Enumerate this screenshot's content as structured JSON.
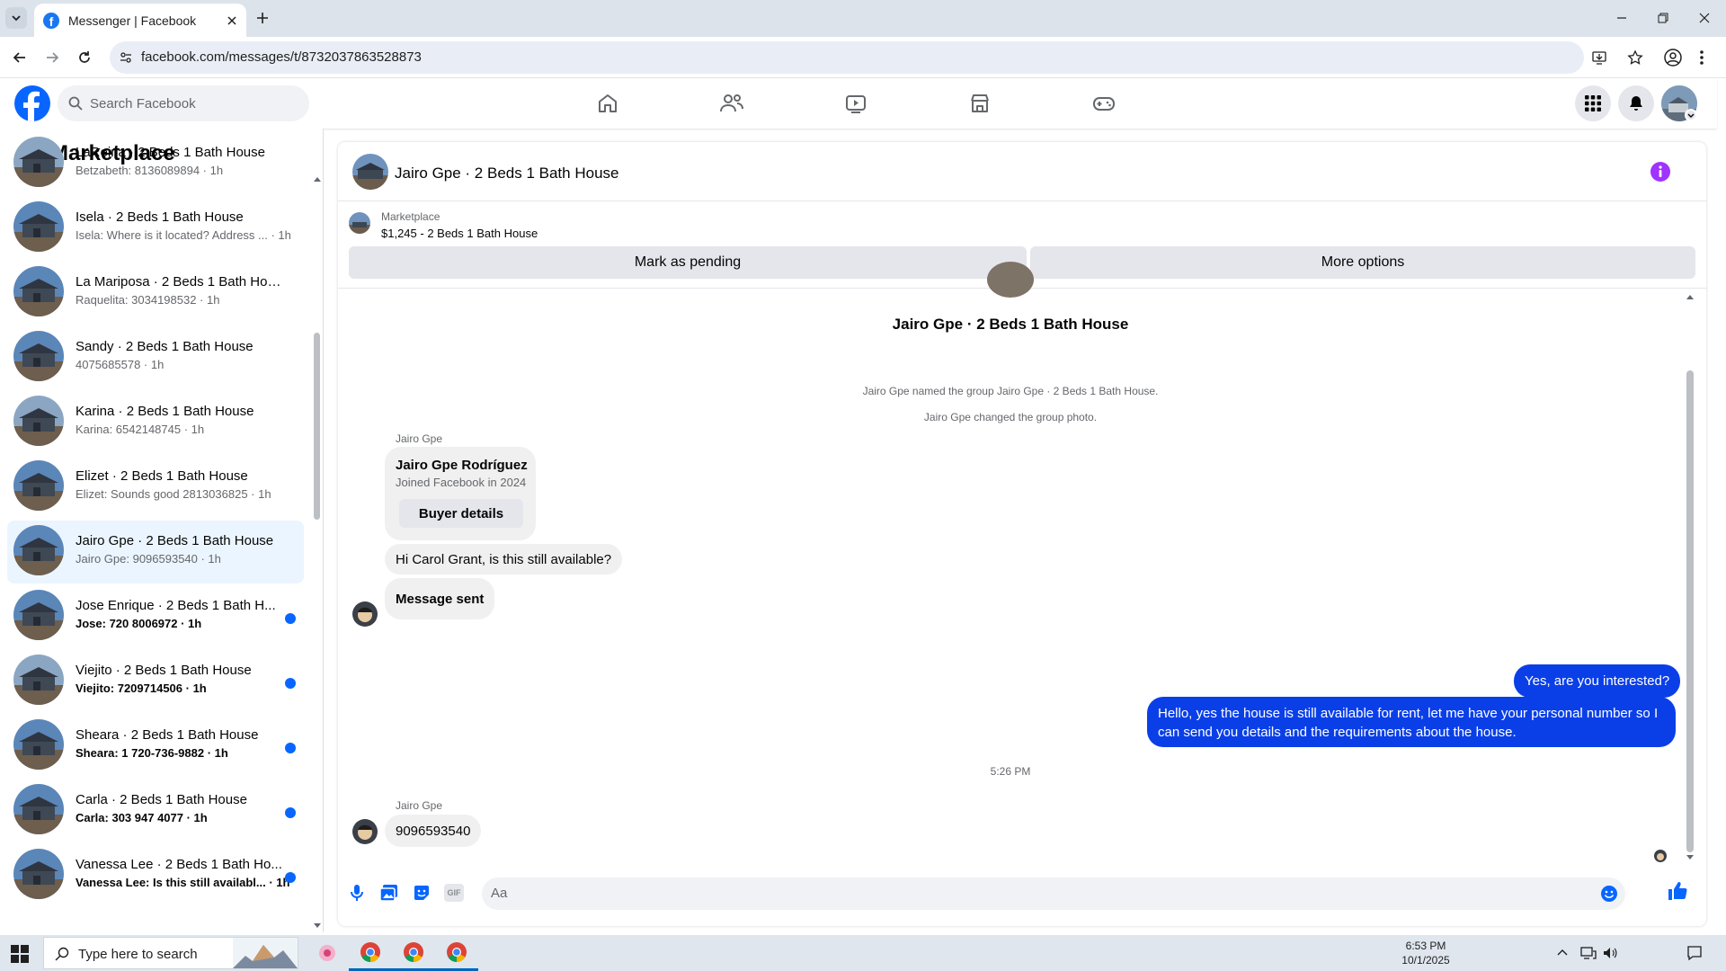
{
  "browser": {
    "tab_title": "Messenger | Facebook",
    "url": "facebook.com/messages/t/8732037863528873"
  },
  "fb_header": {
    "search_placeholder": "Search Facebook"
  },
  "left_pane": {
    "title": "Marketplace",
    "conversations": [
      {
        "name": "LaReina · 2 Beds 1 Bath House",
        "preview": "Betzabeth: 8136089894 · 1h",
        "unread": false,
        "selected": false
      },
      {
        "name": "Isela · 2 Beds 1 Bath House",
        "preview": "Isela: Where is it located? Address ... · 1h",
        "unread": false,
        "selected": false
      },
      {
        "name": "La Mariposa · 2 Beds 1 Bath House",
        "preview": "Raquelita: 3034198532 · 1h",
        "unread": false,
        "selected": false
      },
      {
        "name": "Sandy · 2 Beds 1 Bath House",
        "preview": "4075685578 · 1h",
        "unread": false,
        "selected": false
      },
      {
        "name": "Karina · 2 Beds 1 Bath House",
        "preview": "Karina: 6542148745 · 1h",
        "unread": false,
        "selected": false
      },
      {
        "name": "Elizet · 2 Beds 1 Bath House",
        "preview": "Elizet: Sounds good 2813036825 · 1h",
        "unread": false,
        "selected": false
      },
      {
        "name": "Jairo Gpe · 2 Beds 1 Bath House",
        "preview": "Jairo Gpe: 9096593540 · 1h",
        "unread": false,
        "selected": true
      },
      {
        "name": "Jose Enrique · 2 Beds 1 Bath H...",
        "preview": "Jose: 720 8006972 · 1h",
        "unread": true,
        "selected": false
      },
      {
        "name": "Viejito · 2 Beds 1 Bath House",
        "preview": "Viejito: 7209714506 · 1h",
        "unread": true,
        "selected": false
      },
      {
        "name": "Sheara · 2 Beds 1 Bath House",
        "preview": "Sheara: 1 720-736-9882 · 1h",
        "unread": true,
        "selected": false
      },
      {
        "name": "Carla · 2 Beds 1 Bath House",
        "preview": "Carla: 303 947 4077 · 1h",
        "unread": true,
        "selected": false
      },
      {
        "name": "Vanessa Lee · 2 Beds 1 Bath Ho...",
        "preview": "Vanessa Lee: Is this still availabl... · 1h",
        "unread": true,
        "selected": false
      }
    ]
  },
  "chat": {
    "title": "Jairo Gpe · 2 Beds 1 Bath House",
    "marketplace_label": "Marketplace",
    "listing": "$1,245 - 2 Beds 1 Bath House",
    "mark_pending_label": "Mark as pending",
    "more_options_label": "More options",
    "group_title": "Jairo Gpe · 2 Beds 1 Bath House",
    "system_messages": [
      "Jairo Gpe named the group Jairo Gpe · 2 Beds 1 Bath House.",
      "Jairo Gpe changed the group photo."
    ],
    "sender_name": "Jairo Gpe",
    "profile_card": {
      "name": "Jairo Gpe Rodríguez",
      "joined": "Joined Facebook in 2024",
      "button": "Buyer details"
    },
    "incoming_1": "Hi Carol Grant, is this still available?",
    "incoming_2": "Message sent",
    "outgoing_1": "Yes, are you interested?",
    "outgoing_2": "Hello, yes the house is still available for rent, let me have your personal number so I can send you details and the requirements about the house.",
    "timestamp": "5:26 PM",
    "sender_name_2": "Jairo Gpe",
    "incoming_3": "9096593540",
    "composer_placeholder": "Aa"
  },
  "taskbar": {
    "search_placeholder": "Type here to search",
    "time": "6:53 PM",
    "date": "10/1/2025"
  },
  "colors": {
    "fb_blue": "#0866ff",
    "outgoing_bubble": "#0a3fe8",
    "info_purple": "#a033ff"
  }
}
